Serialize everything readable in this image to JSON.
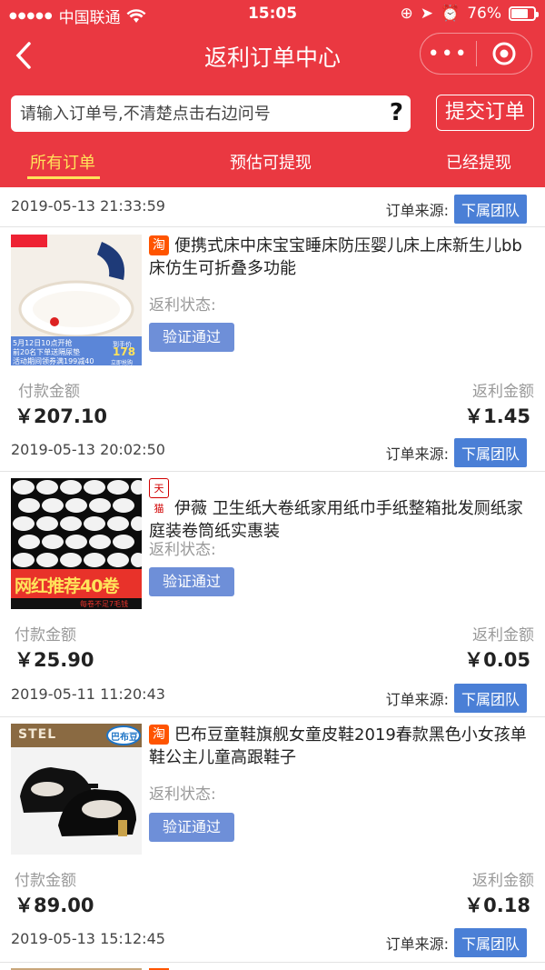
{
  "status_bar": {
    "carrier": "中国联通",
    "time": "15:05",
    "battery": "76%",
    "battery_level": 0.76
  },
  "navbar": {
    "title": "返利订单中心",
    "more": "•••"
  },
  "search": {
    "placeholder": "请输入订单号,不清楚点击右边问号",
    "help": "?",
    "submit_label": "提交订单"
  },
  "tabs": [
    "所有订单",
    "预估可提现",
    "已经提现"
  ],
  "labels": {
    "source": "订单来源:",
    "rebate_status": "返利状态:",
    "pay_amount": "付款金额",
    "rebate_amount": "返利金额"
  },
  "orders": [
    {
      "date": "2019-05-13 21:33:59",
      "source_badge": "下属团队",
      "shop": "淘",
      "title": "便携式床中床宝宝睡床防压婴儿床上床新生儿bb床仿生可折叠多功能",
      "status": "验证通过",
      "pay": "￥207.10",
      "rebate": "￥1.45",
      "thumb_text": [
        "5月12日10点开抢",
        "前20名下单送隔尿垫",
        "活动期间领券满199减40",
        "到手价",
        "178",
        "立即抢购"
      ]
    },
    {
      "date": "2019-05-13 20:02:50",
      "source_badge": "下属团队",
      "shop": "天猫",
      "title": "伊薇 卫生纸大卷纸家用纸巾手纸整箱批发厕纸家庭装卷筒纸实惠装",
      "status": "验证通过",
      "pay": "￥25.90",
      "rebate": "￥0.05",
      "thumb_text": [
        "网红推荐40卷",
        "每卷不足7毛钱"
      ]
    },
    {
      "date": "2019-05-11 11:20:43",
      "source_badge": "下属团队",
      "shop": "淘",
      "title": "巴布豆童鞋旗舰女童皮鞋2019春款黑色小女孩单鞋公主儿童高跟鞋子",
      "status": "验证通过",
      "pay": "￥89.00",
      "rebate": "￥0.18",
      "thumb_text": [
        "STEL",
        "巴布豆"
      ]
    },
    {
      "date": "2019-05-13 15:12:45",
      "source_badge": "下属团队"
    }
  ]
}
